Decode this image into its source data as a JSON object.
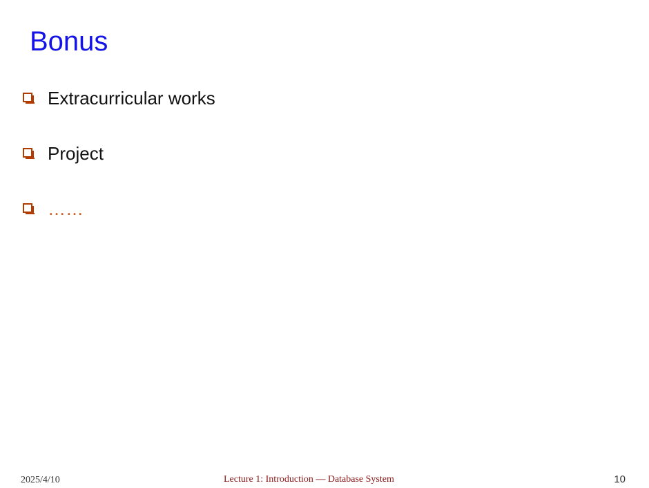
{
  "slide": {
    "title": "Bonus",
    "bullets": [
      {
        "text": "Extracurricular works",
        "style": "normal"
      },
      {
        "text": "Project",
        "style": "normal"
      },
      {
        "text": "……",
        "style": "accent"
      }
    ]
  },
  "footer": {
    "date": "2025/4/10",
    "lecture": "Lecture 1: Introduction — Database System",
    "page_number": "10"
  },
  "colors": {
    "title": "#1414e6",
    "bullet_marker": "#b23c00",
    "accent_text": "#d45a1a",
    "footer_center": "#8b1a1a"
  }
}
